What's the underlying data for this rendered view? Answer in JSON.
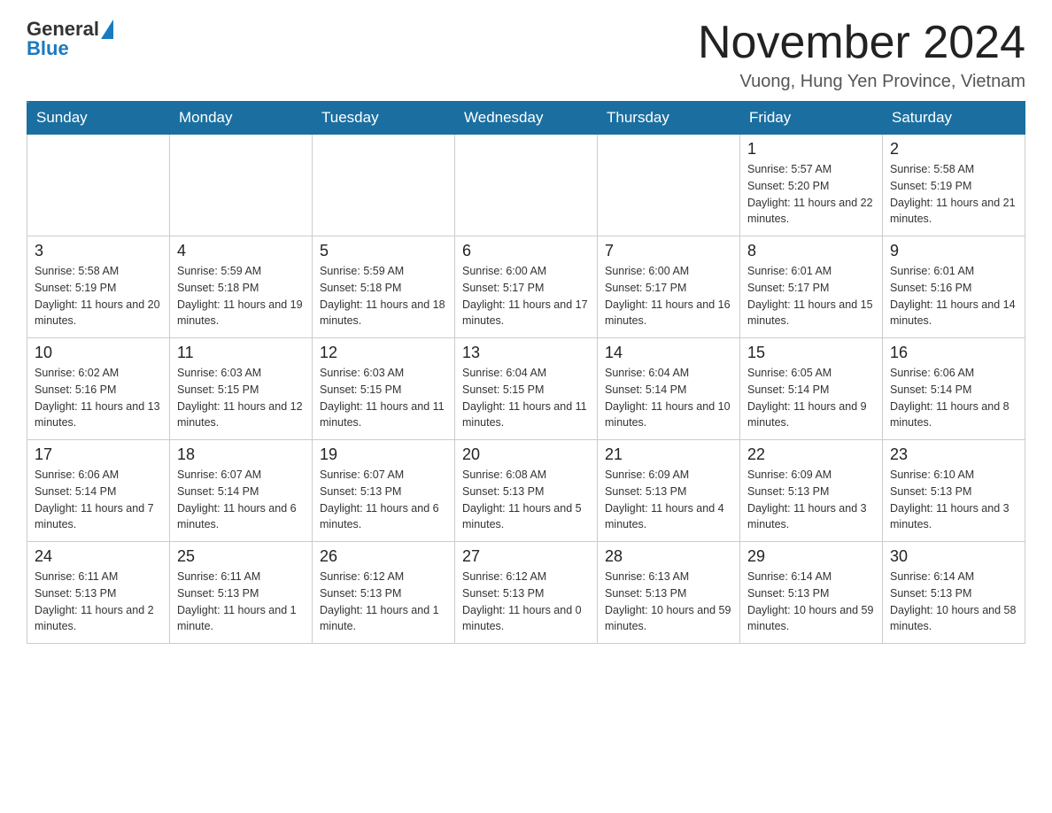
{
  "header": {
    "logo_general": "General",
    "logo_blue": "Blue",
    "month_title": "November 2024",
    "location": "Vuong, Hung Yen Province, Vietnam"
  },
  "days_of_week": [
    "Sunday",
    "Monday",
    "Tuesday",
    "Wednesday",
    "Thursday",
    "Friday",
    "Saturday"
  ],
  "weeks": [
    [
      {
        "day": "",
        "info": ""
      },
      {
        "day": "",
        "info": ""
      },
      {
        "day": "",
        "info": ""
      },
      {
        "day": "",
        "info": ""
      },
      {
        "day": "",
        "info": ""
      },
      {
        "day": "1",
        "info": "Sunrise: 5:57 AM\nSunset: 5:20 PM\nDaylight: 11 hours and 22 minutes."
      },
      {
        "day": "2",
        "info": "Sunrise: 5:58 AM\nSunset: 5:19 PM\nDaylight: 11 hours and 21 minutes."
      }
    ],
    [
      {
        "day": "3",
        "info": "Sunrise: 5:58 AM\nSunset: 5:19 PM\nDaylight: 11 hours and 20 minutes."
      },
      {
        "day": "4",
        "info": "Sunrise: 5:59 AM\nSunset: 5:18 PM\nDaylight: 11 hours and 19 minutes."
      },
      {
        "day": "5",
        "info": "Sunrise: 5:59 AM\nSunset: 5:18 PM\nDaylight: 11 hours and 18 minutes."
      },
      {
        "day": "6",
        "info": "Sunrise: 6:00 AM\nSunset: 5:17 PM\nDaylight: 11 hours and 17 minutes."
      },
      {
        "day": "7",
        "info": "Sunrise: 6:00 AM\nSunset: 5:17 PM\nDaylight: 11 hours and 16 minutes."
      },
      {
        "day": "8",
        "info": "Sunrise: 6:01 AM\nSunset: 5:17 PM\nDaylight: 11 hours and 15 minutes."
      },
      {
        "day": "9",
        "info": "Sunrise: 6:01 AM\nSunset: 5:16 PM\nDaylight: 11 hours and 14 minutes."
      }
    ],
    [
      {
        "day": "10",
        "info": "Sunrise: 6:02 AM\nSunset: 5:16 PM\nDaylight: 11 hours and 13 minutes."
      },
      {
        "day": "11",
        "info": "Sunrise: 6:03 AM\nSunset: 5:15 PM\nDaylight: 11 hours and 12 minutes."
      },
      {
        "day": "12",
        "info": "Sunrise: 6:03 AM\nSunset: 5:15 PM\nDaylight: 11 hours and 11 minutes."
      },
      {
        "day": "13",
        "info": "Sunrise: 6:04 AM\nSunset: 5:15 PM\nDaylight: 11 hours and 11 minutes."
      },
      {
        "day": "14",
        "info": "Sunrise: 6:04 AM\nSunset: 5:14 PM\nDaylight: 11 hours and 10 minutes."
      },
      {
        "day": "15",
        "info": "Sunrise: 6:05 AM\nSunset: 5:14 PM\nDaylight: 11 hours and 9 minutes."
      },
      {
        "day": "16",
        "info": "Sunrise: 6:06 AM\nSunset: 5:14 PM\nDaylight: 11 hours and 8 minutes."
      }
    ],
    [
      {
        "day": "17",
        "info": "Sunrise: 6:06 AM\nSunset: 5:14 PM\nDaylight: 11 hours and 7 minutes."
      },
      {
        "day": "18",
        "info": "Sunrise: 6:07 AM\nSunset: 5:14 PM\nDaylight: 11 hours and 6 minutes."
      },
      {
        "day": "19",
        "info": "Sunrise: 6:07 AM\nSunset: 5:13 PM\nDaylight: 11 hours and 6 minutes."
      },
      {
        "day": "20",
        "info": "Sunrise: 6:08 AM\nSunset: 5:13 PM\nDaylight: 11 hours and 5 minutes."
      },
      {
        "day": "21",
        "info": "Sunrise: 6:09 AM\nSunset: 5:13 PM\nDaylight: 11 hours and 4 minutes."
      },
      {
        "day": "22",
        "info": "Sunrise: 6:09 AM\nSunset: 5:13 PM\nDaylight: 11 hours and 3 minutes."
      },
      {
        "day": "23",
        "info": "Sunrise: 6:10 AM\nSunset: 5:13 PM\nDaylight: 11 hours and 3 minutes."
      }
    ],
    [
      {
        "day": "24",
        "info": "Sunrise: 6:11 AM\nSunset: 5:13 PM\nDaylight: 11 hours and 2 minutes."
      },
      {
        "day": "25",
        "info": "Sunrise: 6:11 AM\nSunset: 5:13 PM\nDaylight: 11 hours and 1 minute."
      },
      {
        "day": "26",
        "info": "Sunrise: 6:12 AM\nSunset: 5:13 PM\nDaylight: 11 hours and 1 minute."
      },
      {
        "day": "27",
        "info": "Sunrise: 6:12 AM\nSunset: 5:13 PM\nDaylight: 11 hours and 0 minutes."
      },
      {
        "day": "28",
        "info": "Sunrise: 6:13 AM\nSunset: 5:13 PM\nDaylight: 10 hours and 59 minutes."
      },
      {
        "day": "29",
        "info": "Sunrise: 6:14 AM\nSunset: 5:13 PM\nDaylight: 10 hours and 59 minutes."
      },
      {
        "day": "30",
        "info": "Sunrise: 6:14 AM\nSunset: 5:13 PM\nDaylight: 10 hours and 58 minutes."
      }
    ]
  ]
}
